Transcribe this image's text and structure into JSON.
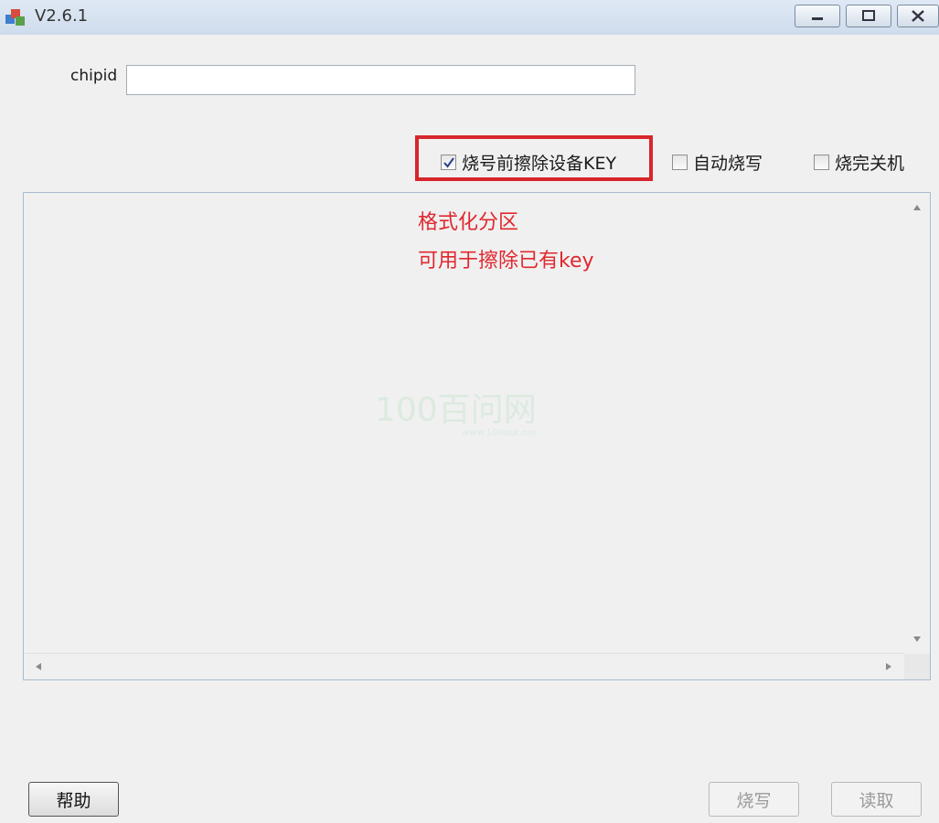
{
  "window": {
    "title": "V2.6.1"
  },
  "form": {
    "chipid_label": "chipid",
    "chipid_value": ""
  },
  "options": [
    {
      "label": "烧号前擦除设备KEY",
      "checked": true
    },
    {
      "label": "自动烧写",
      "checked": false
    },
    {
      "label": "烧完关机",
      "checked": false
    }
  ],
  "log": {
    "annotation_line1": "格式化分区",
    "annotation_line2": "可用于擦除已有key",
    "watermark_text": "100百问网",
    "watermark_url": "www.100ask.net"
  },
  "buttons": {
    "help": "帮助",
    "burn": "烧写",
    "read": "读取"
  },
  "colors": {
    "highlight": "#d7262d",
    "annotation": "#e0282f"
  }
}
